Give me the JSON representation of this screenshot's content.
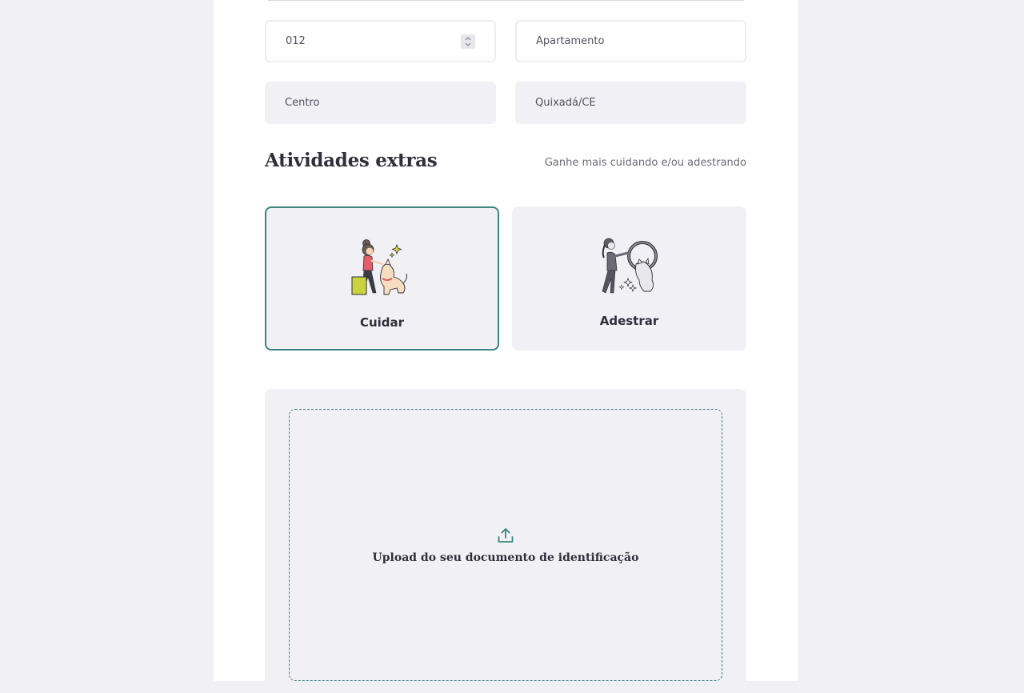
{
  "address": {
    "number_value": "012",
    "complement_placeholder": "Apartamento",
    "neighborhood_value": "Centro",
    "city_value": "Quixadá/CE"
  },
  "extras": {
    "title": "Atividades extras",
    "subtitle": "Ganhe mais cuidando e/ou adestrando",
    "options": [
      {
        "label": "Cuidar",
        "selected": true,
        "icon": "caring-illustration-icon"
      },
      {
        "label": "Adestrar",
        "selected": false,
        "icon": "training-illustration-icon"
      }
    ]
  },
  "upload": {
    "label": "Upload do seu documento de identificação",
    "icon": "upload-icon"
  },
  "colors": {
    "accent": "#3a8580",
    "field_fill": "#f0f0f5",
    "text_dark": "#312f3a"
  }
}
